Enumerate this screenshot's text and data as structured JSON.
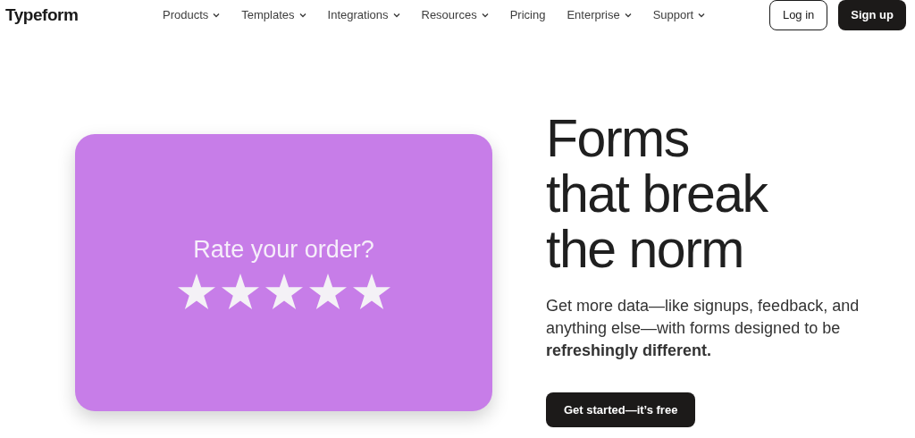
{
  "header": {
    "logo": "Typeform",
    "nav": [
      {
        "label": "Products",
        "dropdown": true
      },
      {
        "label": "Templates",
        "dropdown": true
      },
      {
        "label": "Integrations",
        "dropdown": true
      },
      {
        "label": "Resources",
        "dropdown": true
      },
      {
        "label": "Pricing",
        "dropdown": false
      },
      {
        "label": "Enterprise",
        "dropdown": true
      },
      {
        "label": "Support",
        "dropdown": true
      }
    ],
    "login": "Log in",
    "signup": "Sign up"
  },
  "card": {
    "question": "Rate your order?",
    "stars": 5
  },
  "hero": {
    "headline": [
      "Forms",
      "that break",
      "the norm"
    ],
    "text": "Get more data—like signups, feedback, and anything else—with forms designed to be **refreshingly different.**",
    "cta": "Get started—it’s free"
  }
}
